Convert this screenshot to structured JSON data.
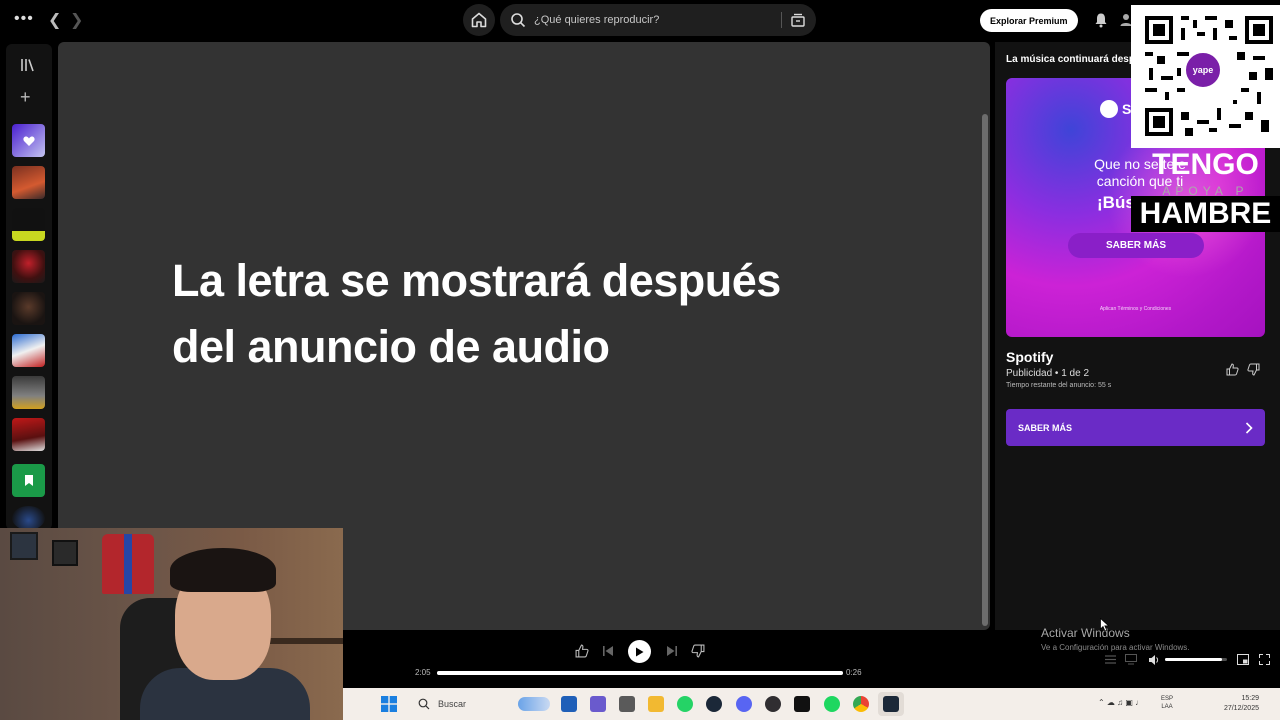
{
  "topbar": {
    "search_placeholder": "¿Qué quieres reproducir?",
    "premium_label": "Explorar Premium"
  },
  "main": {
    "lyrics_message": "La letra se mostrará después del anuncio de audio"
  },
  "right_panel": {
    "header": "La música continuará desp",
    "ad": {
      "logo_text": "S",
      "text_line1": "Que no se te e",
      "text_line2": "canción que ti",
      "text_strong": "¡Búscala p",
      "cta_label": "SABER MÁS",
      "terms": "Aplican Términos y Condiciones"
    },
    "title": "Spotify",
    "subtitle": "Publicidad • 1 de 2",
    "remaining": "Tiempo restante del anuncio: 55 s",
    "cta_label": "SABER MÁS"
  },
  "overlay": {
    "badge": "yape",
    "line1": "TENGO",
    "line2": "APOYA P",
    "line3": "HAMBRE"
  },
  "player": {
    "current_time": "2:05",
    "duration": "0:26",
    "progress": 1.0,
    "volume": 0.92
  },
  "watermark": {
    "line1": "Activar Windows",
    "line2": "Ve a Configuración para activar Windows."
  },
  "taskbar": {
    "search_label": "Buscar",
    "lang_line1": "ESP",
    "lang_line2": "LAA",
    "time": "15:29",
    "date": "27/12/2025"
  },
  "colors": {
    "spotify_green": "#1ed760",
    "ad_purple": "#6a2bc6",
    "panel_bg": "#333333"
  }
}
